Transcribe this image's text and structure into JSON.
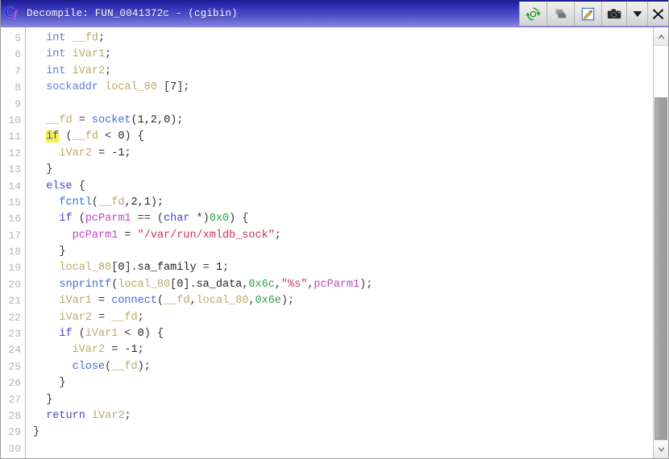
{
  "window": {
    "title": "Decompile: FUN_0041372c -  (cgibin)",
    "app_icon": "decompiler-c-icon",
    "icon_letter": "C",
    "icon_sub": "f"
  },
  "titlebar_tools": [
    {
      "name": "refresh-icon",
      "label": "Refresh",
      "glyph": "refresh"
    },
    {
      "name": "copy-icon",
      "label": "Copy",
      "glyph": "copy"
    },
    {
      "name": "edit-icon",
      "label": "Edit",
      "glyph": "edit"
    },
    {
      "name": "snapshot-icon",
      "label": "Snapshot",
      "glyph": "camera"
    },
    {
      "name": "chevron-down-icon",
      "label": "More options",
      "glyph": "chevron-down"
    },
    {
      "name": "close-icon",
      "label": "Close",
      "glyph": "close"
    }
  ],
  "scrollbar": {
    "up_arrow": "▲",
    "down_arrow": "▼",
    "thumb_top_pct": 13,
    "thumb_height_pct": 87
  },
  "editor": {
    "first_line_number": 5,
    "last_line_number": 30,
    "highlighted_token": "if",
    "highlighted_line": 11,
    "line_numbers": [
      5,
      6,
      7,
      8,
      9,
      10,
      11,
      12,
      13,
      14,
      15,
      16,
      17,
      18,
      19,
      20,
      21,
      22,
      23,
      24,
      25,
      26,
      27,
      28,
      29,
      30
    ],
    "lines": [
      {
        "n": 5,
        "text": "  int __fd;"
      },
      {
        "n": 6,
        "text": "  int iVar1;"
      },
      {
        "n": 7,
        "text": "  int iVar2;"
      },
      {
        "n": 8,
        "text": "  sockaddr local_80 [7];"
      },
      {
        "n": 9,
        "text": ""
      },
      {
        "n": 10,
        "text": "  __fd = socket(1,2,0);"
      },
      {
        "n": 11,
        "text": "  if (__fd < 0) {"
      },
      {
        "n": 12,
        "text": "    iVar2 = -1;"
      },
      {
        "n": 13,
        "text": "  }"
      },
      {
        "n": 14,
        "text": "  else {"
      },
      {
        "n": 15,
        "text": "    fcntl(__fd,2,1);"
      },
      {
        "n": 16,
        "text": "    if (pcParm1 == (char *)0x0) {"
      },
      {
        "n": 17,
        "text": "      pcParm1 = \"/var/run/xmldb_sock\";"
      },
      {
        "n": 18,
        "text": "    }"
      },
      {
        "n": 19,
        "text": "    local_80[0].sa_family = 1;"
      },
      {
        "n": 20,
        "text": "    snprintf(local_80[0].sa_data,0x6c,\"%s\",pcParm1);"
      },
      {
        "n": 21,
        "text": "    iVar1 = connect(__fd,local_80,0x6e);"
      },
      {
        "n": 22,
        "text": "    iVar2 = __fd;"
      },
      {
        "n": 23,
        "text": "    if (iVar1 < 0) {"
      },
      {
        "n": 24,
        "text": "      iVar2 = -1;"
      },
      {
        "n": 25,
        "text": "      close(__fd);"
      },
      {
        "n": 26,
        "text": "    }"
      },
      {
        "n": 27,
        "text": "  }"
      },
      {
        "n": 28,
        "text": "  return iVar2;"
      },
      {
        "n": 29,
        "text": "}"
      },
      {
        "n": 30,
        "text": ""
      }
    ],
    "tokens": [
      {
        "n": 5,
        "spans": [
          [
            "  ",
            "plain"
          ],
          [
            "int",
            "type"
          ],
          [
            " ",
            "plain"
          ],
          [
            "__fd",
            "var"
          ],
          [
            ";",
            "punc"
          ]
        ]
      },
      {
        "n": 6,
        "spans": [
          [
            "  ",
            "plain"
          ],
          [
            "int",
            "type"
          ],
          [
            " ",
            "plain"
          ],
          [
            "iVar1",
            "var"
          ],
          [
            ";",
            "punc"
          ]
        ]
      },
      {
        "n": 7,
        "spans": [
          [
            "  ",
            "plain"
          ],
          [
            "int",
            "type"
          ],
          [
            " ",
            "plain"
          ],
          [
            "iVar2",
            "var"
          ],
          [
            ";",
            "punc"
          ]
        ]
      },
      {
        "n": 8,
        "spans": [
          [
            "  ",
            "plain"
          ],
          [
            "sockaddr",
            "type"
          ],
          [
            " ",
            "plain"
          ],
          [
            "local_80",
            "var"
          ],
          [
            " [",
            "punc"
          ],
          [
            "7",
            "plain"
          ],
          [
            "];",
            "punc"
          ]
        ]
      },
      {
        "n": 9,
        "spans": [
          [
            "",
            "plain"
          ]
        ]
      },
      {
        "n": 10,
        "spans": [
          [
            "  ",
            "plain"
          ],
          [
            "__fd",
            "var"
          ],
          [
            " = ",
            "punc"
          ],
          [
            "socket",
            "fn"
          ],
          [
            "(",
            "punc"
          ],
          [
            "1",
            "plain"
          ],
          [
            ",",
            "punc"
          ],
          [
            "2",
            "plain"
          ],
          [
            ",",
            "punc"
          ],
          [
            "0",
            "plain"
          ],
          [
            ");",
            "punc"
          ]
        ]
      },
      {
        "n": 11,
        "spans": [
          [
            "  ",
            "plain"
          ],
          [
            "if",
            "kw-hl"
          ],
          [
            " (",
            "punc"
          ],
          [
            "__fd",
            "var"
          ],
          [
            " < ",
            "punc"
          ],
          [
            "0",
            "plain"
          ],
          [
            ") {",
            "punc"
          ]
        ]
      },
      {
        "n": 12,
        "spans": [
          [
            "    ",
            "plain"
          ],
          [
            "iVar2",
            "var"
          ],
          [
            " = -",
            "punc"
          ],
          [
            "1",
            "plain"
          ],
          [
            ";",
            "punc"
          ]
        ]
      },
      {
        "n": 13,
        "spans": [
          [
            "  }",
            "punc"
          ]
        ]
      },
      {
        "n": 14,
        "spans": [
          [
            "  ",
            "plain"
          ],
          [
            "else",
            "kw"
          ],
          [
            " {",
            "punc"
          ]
        ]
      },
      {
        "n": 15,
        "spans": [
          [
            "    ",
            "plain"
          ],
          [
            "fcntl",
            "fn"
          ],
          [
            "(",
            "punc"
          ],
          [
            "__fd",
            "var"
          ],
          [
            ",",
            "punc"
          ],
          [
            "2",
            "plain"
          ],
          [
            ",",
            "punc"
          ],
          [
            "1",
            "plain"
          ],
          [
            ");",
            "punc"
          ]
        ]
      },
      {
        "n": 16,
        "spans": [
          [
            "    ",
            "plain"
          ],
          [
            "if",
            "kw"
          ],
          [
            " (",
            "punc"
          ],
          [
            "pcParm1",
            "param"
          ],
          [
            " == (",
            "punc"
          ],
          [
            "char",
            "kw"
          ],
          [
            " *)",
            "punc"
          ],
          [
            "0x0",
            "num"
          ],
          [
            ") {",
            "punc"
          ]
        ]
      },
      {
        "n": 17,
        "spans": [
          [
            "      ",
            "plain"
          ],
          [
            "pcParm1",
            "param"
          ],
          [
            " = ",
            "punc"
          ],
          [
            "\"/var/run/xmldb_sock\"",
            "str"
          ],
          [
            ";",
            "punc"
          ]
        ]
      },
      {
        "n": 18,
        "spans": [
          [
            "    }",
            "punc"
          ]
        ]
      },
      {
        "n": 19,
        "spans": [
          [
            "    ",
            "plain"
          ],
          [
            "local_80",
            "var"
          ],
          [
            "[",
            "punc"
          ],
          [
            "0",
            "plain"
          ],
          [
            "].",
            "punc"
          ],
          [
            "sa_family",
            "plain"
          ],
          [
            " = ",
            "punc"
          ],
          [
            "1",
            "plain"
          ],
          [
            ";",
            "punc"
          ]
        ]
      },
      {
        "n": 20,
        "spans": [
          [
            "    ",
            "plain"
          ],
          [
            "snprintf",
            "fn"
          ],
          [
            "(",
            "punc"
          ],
          [
            "local_80",
            "var"
          ],
          [
            "[",
            "punc"
          ],
          [
            "0",
            "plain"
          ],
          [
            "].",
            "punc"
          ],
          [
            "sa_data",
            "plain"
          ],
          [
            ",",
            "punc"
          ],
          [
            "0x6c",
            "num"
          ],
          [
            ",",
            "punc"
          ],
          [
            "\"%s\"",
            "str"
          ],
          [
            ",",
            "punc"
          ],
          [
            "pcParm1",
            "param"
          ],
          [
            ");",
            "punc"
          ]
        ]
      },
      {
        "n": 21,
        "spans": [
          [
            "    ",
            "plain"
          ],
          [
            "iVar1",
            "var"
          ],
          [
            " = ",
            "punc"
          ],
          [
            "connect",
            "fn"
          ],
          [
            "(",
            "punc"
          ],
          [
            "__fd",
            "var"
          ],
          [
            ",",
            "punc"
          ],
          [
            "local_80",
            "var"
          ],
          [
            ",",
            "punc"
          ],
          [
            "0x6e",
            "num"
          ],
          [
            ");",
            "punc"
          ]
        ]
      },
      {
        "n": 22,
        "spans": [
          [
            "    ",
            "plain"
          ],
          [
            "iVar2",
            "var"
          ],
          [
            " = ",
            "punc"
          ],
          [
            "__fd",
            "var"
          ],
          [
            ";",
            "punc"
          ]
        ]
      },
      {
        "n": 23,
        "spans": [
          [
            "    ",
            "plain"
          ],
          [
            "if",
            "kw"
          ],
          [
            " (",
            "punc"
          ],
          [
            "iVar1",
            "var"
          ],
          [
            " < ",
            "punc"
          ],
          [
            "0",
            "plain"
          ],
          [
            ") {",
            "punc"
          ]
        ]
      },
      {
        "n": 24,
        "spans": [
          [
            "      ",
            "plain"
          ],
          [
            "iVar2",
            "var"
          ],
          [
            " = -",
            "punc"
          ],
          [
            "1",
            "plain"
          ],
          [
            ";",
            "punc"
          ]
        ]
      },
      {
        "n": 25,
        "spans": [
          [
            "      ",
            "plain"
          ],
          [
            "close",
            "fn"
          ],
          [
            "(",
            "punc"
          ],
          [
            "__fd",
            "var"
          ],
          [
            ");",
            "punc"
          ]
        ]
      },
      {
        "n": 26,
        "spans": [
          [
            "    }",
            "punc"
          ]
        ]
      },
      {
        "n": 27,
        "spans": [
          [
            "  }",
            "punc"
          ]
        ]
      },
      {
        "n": 28,
        "spans": [
          [
            "  ",
            "plain"
          ],
          [
            "return",
            "kw"
          ],
          [
            " ",
            "plain"
          ],
          [
            "iVar2",
            "var"
          ],
          [
            ";",
            "punc"
          ]
        ]
      },
      {
        "n": 29,
        "spans": [
          [
            "}",
            "punc"
          ]
        ]
      },
      {
        "n": 30,
        "spans": [
          [
            "",
            "plain"
          ]
        ]
      }
    ]
  },
  "colors": {
    "titlebar_start": "#1a1a8f",
    "titlebar_end": "#8a8ae0",
    "keyword": "#4444cc",
    "type": "#5c7fd6",
    "function": "#3f6fd0",
    "variable": "#b9aa6a",
    "parameter": "#c048c0",
    "number": "#2f9f48",
    "string": "#cc3355",
    "highlight": "#f4f24a",
    "gutter_text": "#b5b5b5",
    "background": "#ffffff"
  }
}
